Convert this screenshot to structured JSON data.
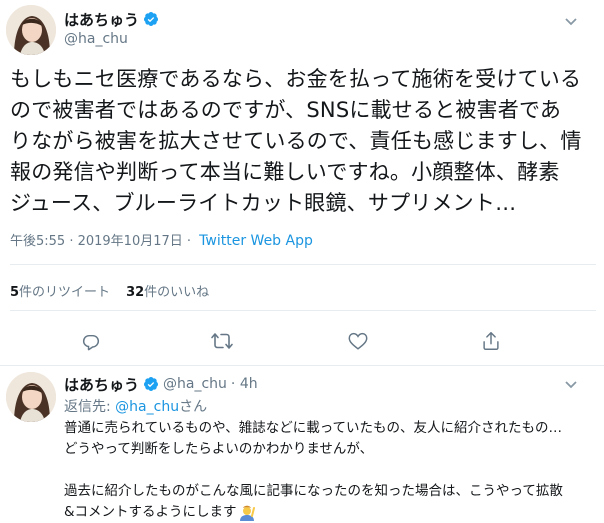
{
  "tweet": {
    "display_name": "はあちゅう",
    "handle": "@ha_chu",
    "body_lines": [
      "もしもニセ医療であるなら、お金を払って施術を受けている",
      "ので被害者ではあるのですが、SNSに載せると被害者であ",
      "りながら被害を拡大させているので、責任も感じますし、情",
      "報の発信や判断って本当に難しいですね。小顔整体、酵素",
      "ジュース、ブルーライトカット眼鏡、サプリメント…"
    ],
    "time": "午後5:55 · 2019年10月17日 ·",
    "source": "Twitter Web App",
    "stats": {
      "retweets_count": "5",
      "retweets_label": "件のリツイート",
      "likes_count": "32",
      "likes_label": "件のいいね"
    }
  },
  "reply": {
    "display_name": "はあちゅう",
    "handle": "@ha_chu",
    "age": "· 4h",
    "reply_to_label": "返信先:",
    "reply_to_handle": "@ha_chu",
    "reply_to_suffix": "さん",
    "lines": [
      "普通に売られているものや、雑誌などに載っていたもの、友人に紹介されたもの…",
      "どうやって判断をしたらよいのかわかりませんが、",
      "",
      "過去に紹介したものがこんな風に記事になったのを知った場合は、こうやって拡散",
      "&コメントするようにします"
    ]
  },
  "icons": {
    "verified": "verified-badge-icon",
    "chevron": "chevron-down-icon",
    "reply": "reply-icon",
    "retweet": "retweet-icon",
    "like": "heart-icon",
    "share": "share-icon",
    "emoji": "person-raising-hand-emoji"
  },
  "colors": {
    "accent": "#1b95e0",
    "verified": "#1da1f2",
    "muted": "#657786",
    "divider": "#e6ecf0"
  }
}
